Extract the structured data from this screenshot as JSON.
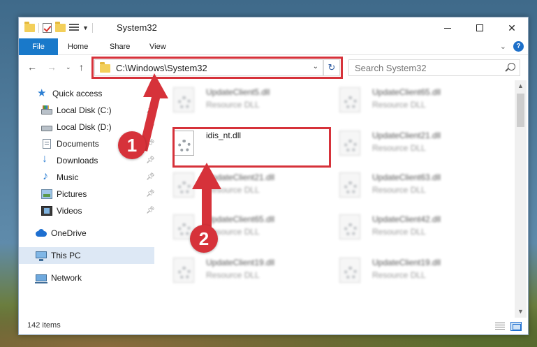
{
  "window": {
    "title": "System32"
  },
  "ribbon": {
    "tabs": [
      "File",
      "Home",
      "Share",
      "View"
    ]
  },
  "address": {
    "path": "C:\\Windows\\System32"
  },
  "search": {
    "placeholder": "Search System32"
  },
  "sidebar": {
    "items": [
      {
        "label": "Quick access",
        "icon": "star-icon",
        "pinned": false
      },
      {
        "label": "Local Disk (C:)",
        "icon": "drive-icon",
        "pinned": true
      },
      {
        "label": "Local Disk (D:)",
        "icon": "drive-icon",
        "pinned": true
      },
      {
        "label": "Documents",
        "icon": "documents-icon",
        "pinned": true
      },
      {
        "label": "Downloads",
        "icon": "downloads-icon",
        "pinned": true
      },
      {
        "label": "Music",
        "icon": "music-icon",
        "pinned": true
      },
      {
        "label": "Pictures",
        "icon": "pictures-icon",
        "pinned": true
      },
      {
        "label": "Videos",
        "icon": "videos-icon",
        "pinned": true
      },
      {
        "label": "OneDrive",
        "icon": "onedrive-icon",
        "pinned": false
      },
      {
        "label": "This PC",
        "icon": "pc-icon",
        "pinned": false,
        "selected": true
      },
      {
        "label": "Network",
        "icon": "network-icon",
        "pinned": false
      }
    ]
  },
  "files": [
    {
      "name": "UpdateClient5.dll",
      "type": "Resource DLL"
    },
    {
      "name": "UpdateClient65.dll",
      "type": "Resource DLL"
    },
    {
      "name": "idis_nt.dll",
      "type": ""
    },
    {
      "name": "UpdateClient21.dll",
      "type": "Resource DLL"
    },
    {
      "name": "UpdateClient21.dll",
      "type": "Resource DLL"
    },
    {
      "name": "UpdateClient63.dll",
      "type": "Resource DLL"
    },
    {
      "name": "UpdateClient65.dll",
      "type": "Resource DLL"
    },
    {
      "name": "UpdateClient42.dll",
      "type": "Resource DLL"
    },
    {
      "name": "UpdateClient19.dll",
      "type": "Resource DLL"
    },
    {
      "name": "UpdateClient19.dll",
      "type": "Resource DLL"
    }
  ],
  "status": {
    "item_count": "142 items"
  },
  "annotations": {
    "step1": "1",
    "step2": "2"
  },
  "colors": {
    "accent": "#1979ca",
    "highlight": "#d6323a",
    "selection": "#dde8f5"
  }
}
